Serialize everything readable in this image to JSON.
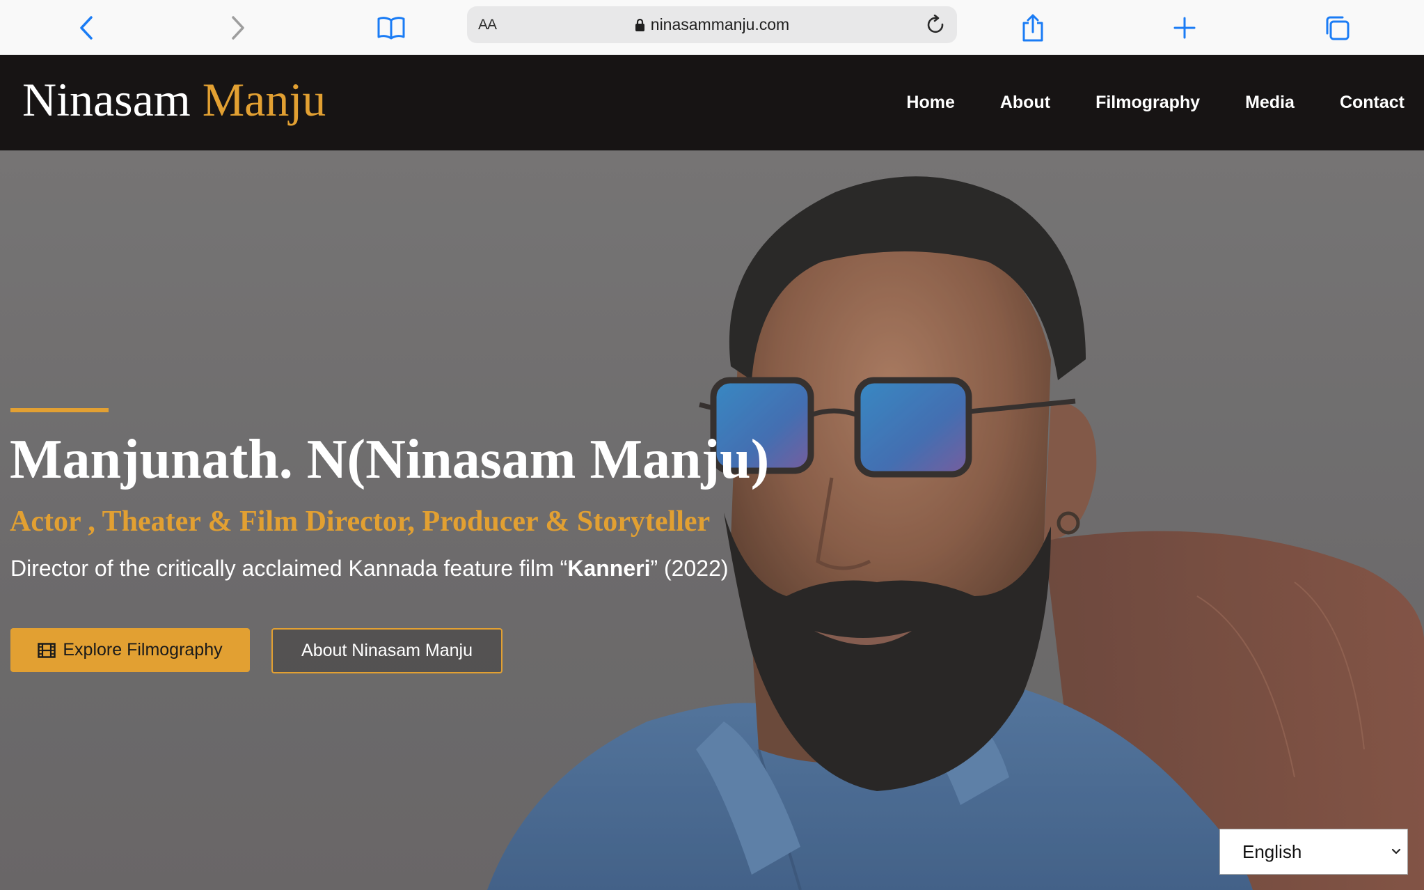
{
  "browser": {
    "text_size_label": "AA",
    "url": "ninasammanju.com",
    "icons": [
      "back-icon",
      "forward-icon",
      "bookmarks-icon",
      "lock-icon",
      "reload-icon",
      "share-icon",
      "new-tab-icon",
      "tabs-icon"
    ]
  },
  "header": {
    "logo_first": "Ninasam",
    "logo_second": "Manju",
    "nav": [
      {
        "label": "Home"
      },
      {
        "label": "About"
      },
      {
        "label": "Filmography"
      },
      {
        "label": "Media"
      },
      {
        "label": "Contact"
      }
    ]
  },
  "hero": {
    "title": "Manjunath. N(Ninasam Manju)",
    "subtitle": "Actor , Theater & Film Director, Producer & Storyteller",
    "desc_before": "Director of the critically acclaimed Kannada feature film “",
    "desc_highlight": "Kanneri",
    "desc_after": "” (2022)",
    "primary_button": "Explore Filmography",
    "secondary_button": "About Ninasam Manju"
  },
  "language": {
    "selected": "English"
  },
  "colors": {
    "accent": "#e2a032",
    "header_bg": "#171414",
    "ios_blue": "#1a7cf5"
  }
}
